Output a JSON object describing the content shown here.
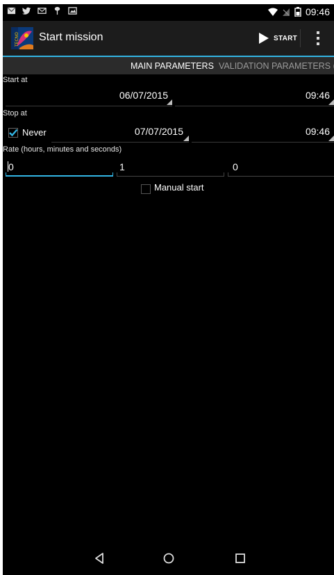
{
  "status_bar": {
    "time": "09:46",
    "left_icons": [
      "gmail-icon",
      "twitter-icon",
      "email-icon",
      "plant-icon",
      "photo-icon"
    ],
    "right_icons": [
      "wifi-icon",
      "no-signal-icon",
      "battery-icon"
    ]
  },
  "action_bar": {
    "title": "Start mission",
    "start_label": "START",
    "logo_icon": "tecno-app-logo-icon",
    "overflow_icon": "overflow-menu-icon"
  },
  "tabs": [
    {
      "label": "MAIN PARAMETERS",
      "selected": true
    },
    {
      "label": "VALIDATION PARAMETERS (°",
      "selected": false
    }
  ],
  "form": {
    "start_at": {
      "label": "Start at",
      "date": "06/07/2015",
      "time": "09:46"
    },
    "stop_at": {
      "label": "Stop at",
      "never_label": "Never",
      "never_checked": true,
      "date": "07/07/2015",
      "time": "09:46"
    },
    "rate": {
      "label": "Rate (hours, minutes and seconds)",
      "hours": "0",
      "minutes": "1",
      "seconds": "0"
    },
    "manual_start": {
      "label": "Manual start",
      "checked": false
    }
  },
  "nav_bar": {
    "buttons": [
      "back-icon",
      "home-icon",
      "recents-icon"
    ]
  },
  "colors": {
    "accent": "#33b5e5",
    "background": "#000000",
    "actionbar": "#1c1c1c",
    "tabbar": "#2b2b2b"
  }
}
